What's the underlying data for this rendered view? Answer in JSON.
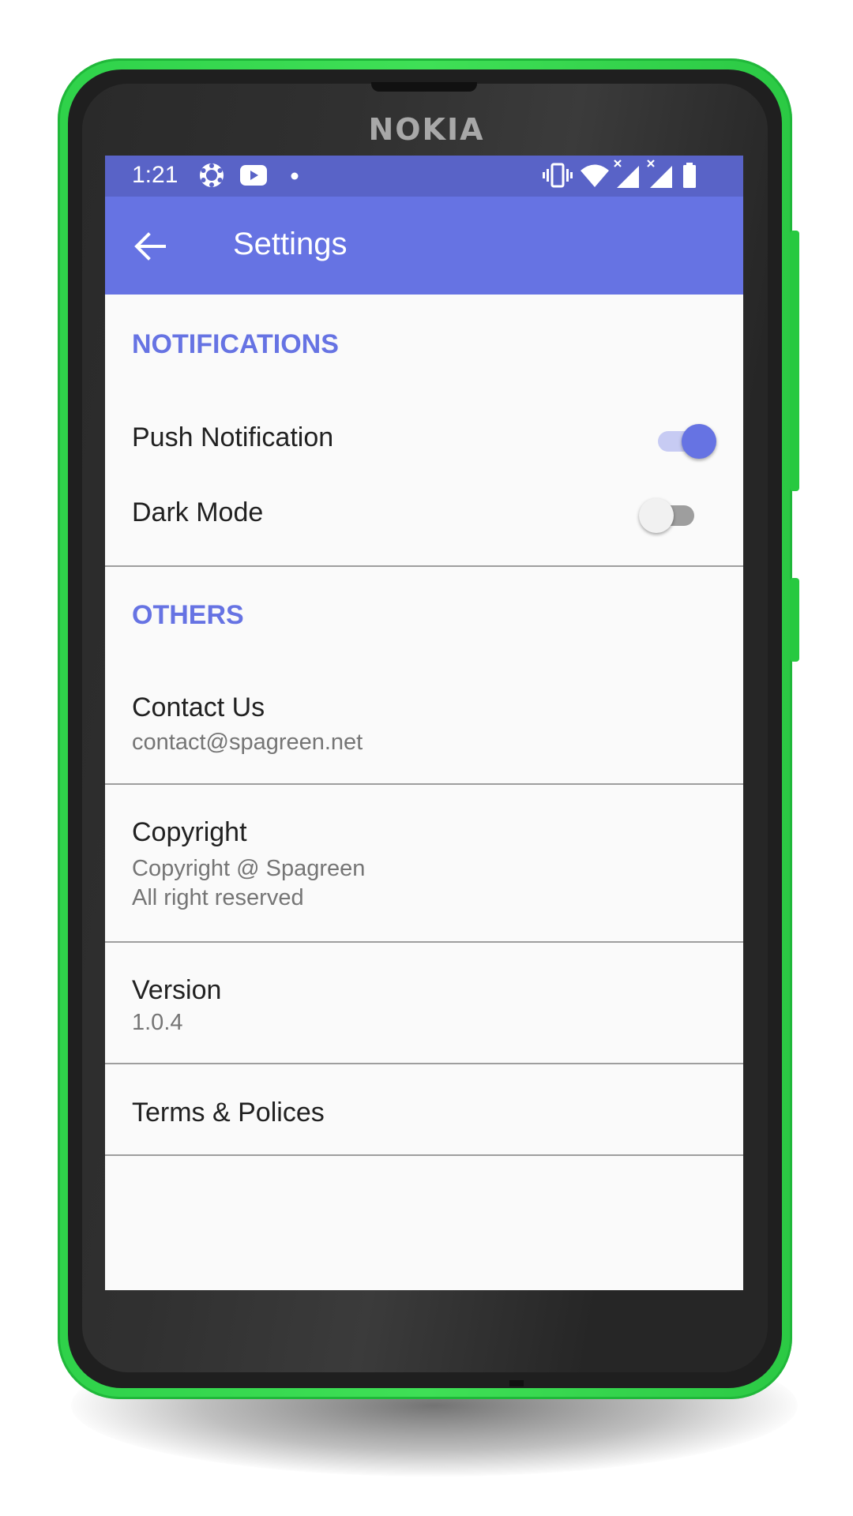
{
  "device": {
    "brand": "NOKIA"
  },
  "status_bar": {
    "time": "1:21",
    "icons": [
      "settings-app-icon",
      "youtube-icon",
      "notification-dot-icon",
      "vibrate-icon",
      "wifi-icon",
      "signal-icon",
      "signal-icon",
      "battery-icon"
    ]
  },
  "toolbar": {
    "title": "Settings",
    "back_icon": "arrow-back-icon"
  },
  "notifications": {
    "header": "NOTIFICATIONS",
    "push_label": "Push Notification",
    "push_enabled": true,
    "dark_label": "Dark Mode",
    "dark_enabled": false
  },
  "others": {
    "header": "OTHERS",
    "contact_title": "Contact Us",
    "contact_value": "contact@spagreen.net",
    "copyright_title": "Copyright",
    "copyright_line1": "Copyright @ Spagreen",
    "copyright_line2": "All right reserved",
    "version_title": "Version",
    "version_value": "1.0.4",
    "terms_title": "Terms & Polices"
  },
  "colors": {
    "accent": "#6673e3",
    "status_bar": "#5963c7",
    "phone_body": "#3fe056"
  }
}
